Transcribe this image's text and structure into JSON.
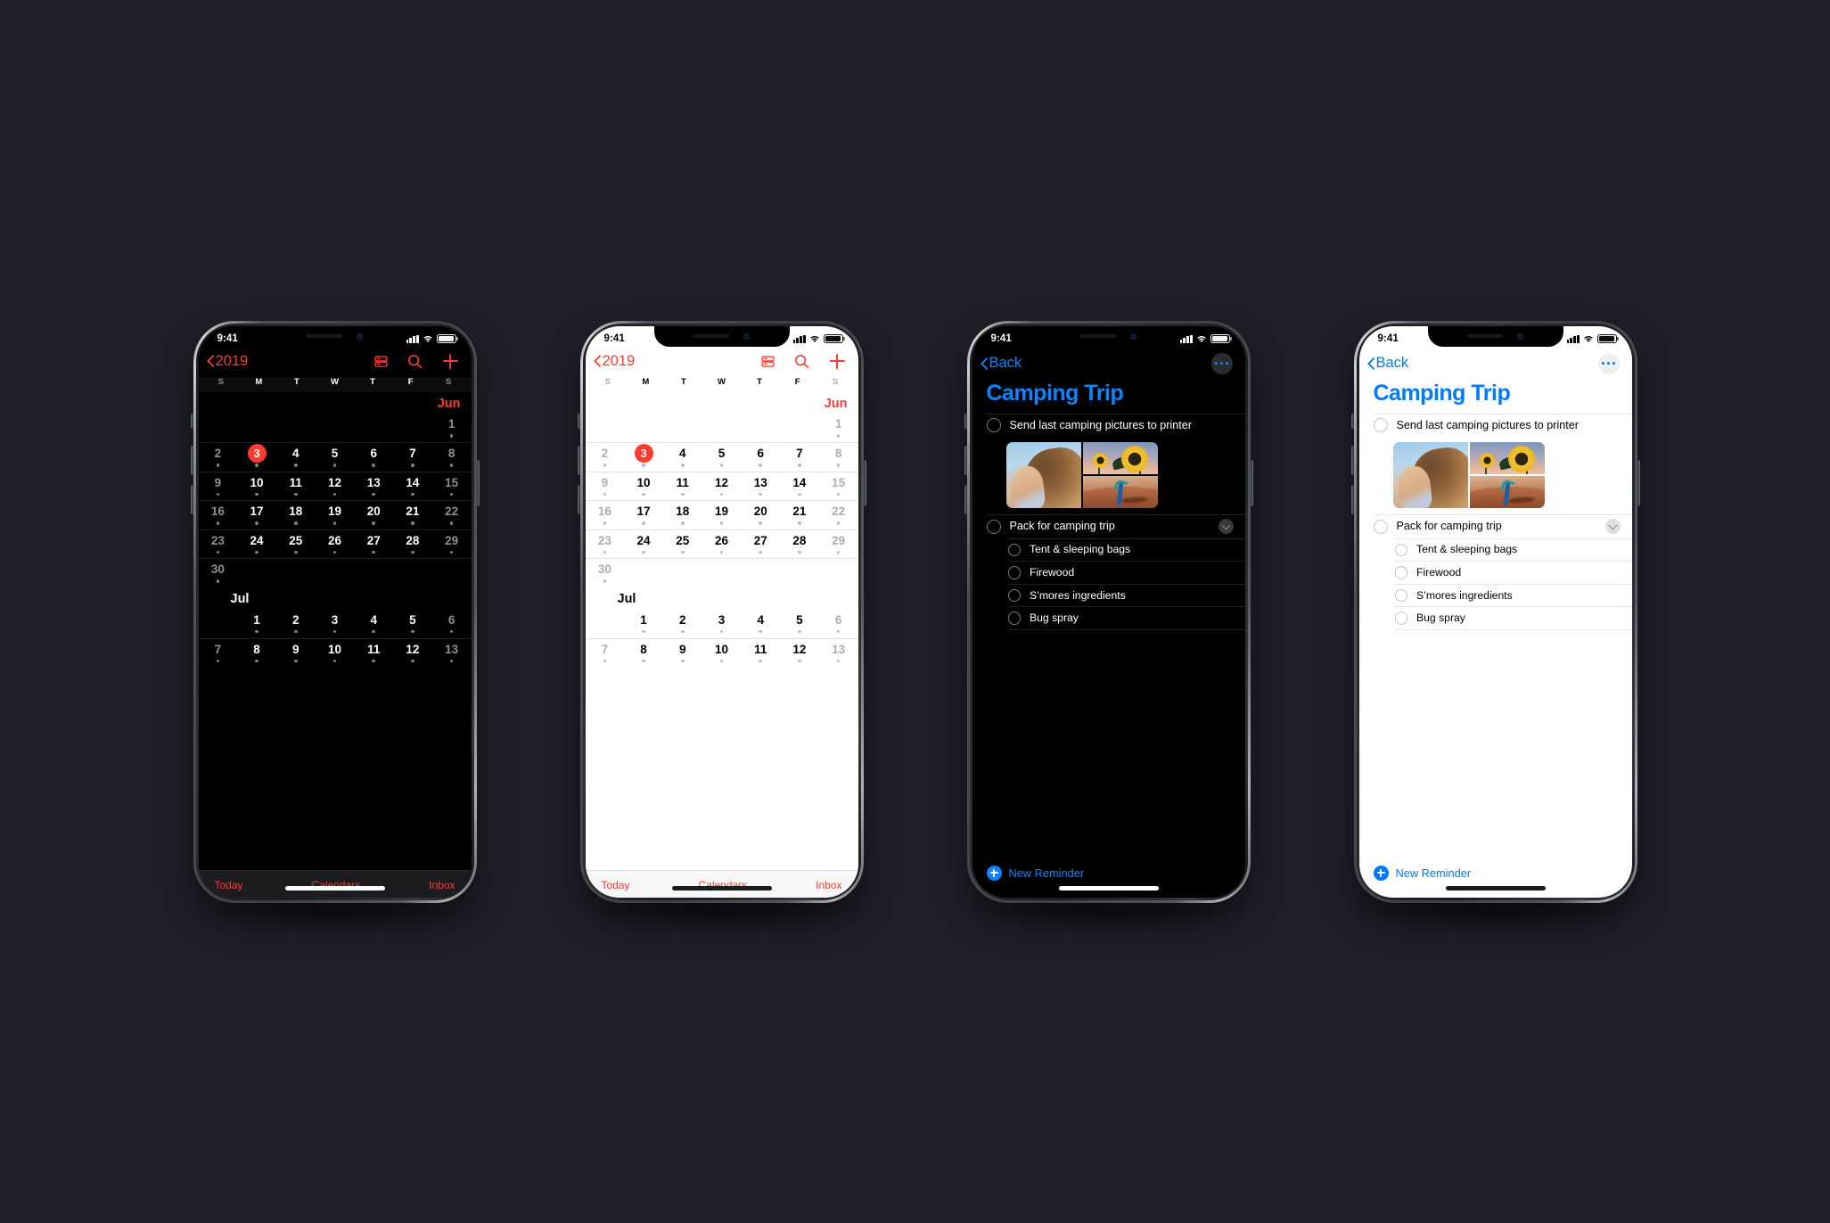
{
  "scene": {
    "background_color": "#201F29",
    "phone_count": 4
  },
  "status_bar": {
    "time": "9:41",
    "signal": "cellular-signal",
    "wifi": "wifi",
    "battery": "battery-full"
  },
  "calendar_app": {
    "nav": {
      "back_label": "2019",
      "list_icon": "calendar-list-icon",
      "search_icon": "search-icon",
      "add_icon": "plus-icon"
    },
    "weekdays": [
      "S",
      "M",
      "T",
      "W",
      "T",
      "F",
      "S"
    ],
    "accent_color": "#FF3B30",
    "months": [
      {
        "name": "Jun",
        "name_align": "right",
        "rows": [
          [
            null,
            null,
            null,
            null,
            null,
            null,
            1
          ],
          [
            2,
            3,
            4,
            5,
            6,
            7,
            8
          ],
          [
            9,
            10,
            11,
            12,
            13,
            14,
            15
          ],
          [
            16,
            17,
            18,
            19,
            20,
            21,
            22
          ],
          [
            23,
            24,
            25,
            26,
            27,
            28,
            29
          ],
          [
            30,
            null,
            null,
            null,
            null,
            null,
            null
          ]
        ]
      },
      {
        "name": "Jul",
        "name_align": "left",
        "rows": [
          [
            null,
            1,
            2,
            3,
            4,
            5,
            6
          ],
          [
            7,
            8,
            9,
            10,
            11,
            12,
            13
          ]
        ]
      }
    ],
    "today": 3,
    "today_month": "Jun",
    "tab_bar": {
      "today": "Today",
      "calendars": "Calendars",
      "inbox": "Inbox"
    }
  },
  "reminders_app": {
    "nav": {
      "back_label": "Back",
      "more_icon": "ellipsis-icon"
    },
    "title": "Camping Trip",
    "accent_color_dark": "#0A84FF",
    "accent_color_light": "#007AFF",
    "items": [
      {
        "text": "Send last camping pictures to printer",
        "has_attachment": true,
        "level": 0
      },
      {
        "text": "Pack for camping trip",
        "collapsible": true,
        "level": 0
      },
      {
        "text": "Tent & sleeping bags",
        "level": 1
      },
      {
        "text": "Firewood",
        "level": 1
      },
      {
        "text": "S’mores ingredients",
        "level": 1
      },
      {
        "text": "Bug spray",
        "level": 1
      }
    ],
    "attachment": {
      "photos": [
        "portrait-woman-curly-hair",
        "sunflowers-at-sunset",
        "handstand-on-red-dirt"
      ]
    },
    "collapse_icon": "chevron-down-icon",
    "new_reminder": {
      "label": "New Reminder",
      "icon": "plus-circle-icon"
    }
  },
  "phones": [
    {
      "id": "phone-calendar-dark",
      "app": "calendar",
      "theme": "dark"
    },
    {
      "id": "phone-calendar-light",
      "app": "calendar",
      "theme": "light"
    },
    {
      "id": "phone-reminders-dark",
      "app": "reminders",
      "theme": "dark"
    },
    {
      "id": "phone-reminders-light",
      "app": "reminders",
      "theme": "light"
    }
  ]
}
